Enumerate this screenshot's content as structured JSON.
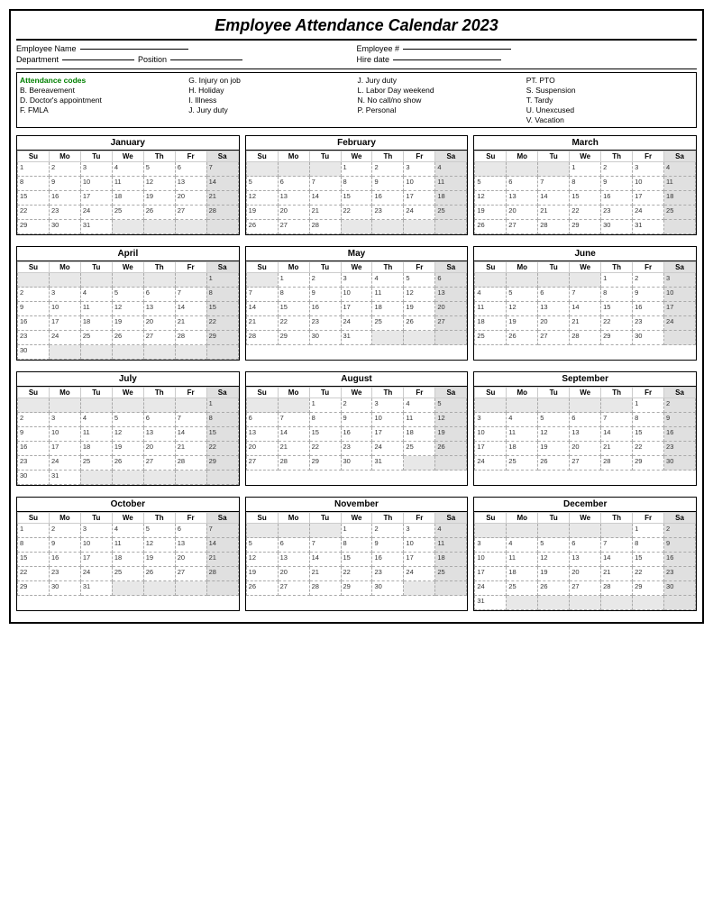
{
  "title": "Employee Attendance Calendar 2023",
  "fields": {
    "emp_name_label": "Employee Name",
    "dept_label": "Department",
    "position_label": "Position",
    "emp_num_label": "Employee #",
    "hire_date_label": "Hire date"
  },
  "codes": {
    "title": "Attendance codes",
    "col1": [
      "B. Bereavement",
      "D. Doctor's appointment",
      "F.  FMLA"
    ],
    "col2": [
      "G. Injury on job",
      "H. Holiday",
      "I.  Illness",
      "J. Jury duty"
    ],
    "col3": [
      "J.  Jury duty",
      "L. Labor Day weekend",
      "N. No call/no show",
      "P. Personal"
    ],
    "col4": [
      "PT. PTO",
      "S. Suspension",
      "T. Tardy",
      "U. Unexcused",
      "V. Vacation"
    ]
  },
  "months": [
    {
      "name": "January",
      "days": [
        1,
        2,
        3,
        4,
        5,
        6,
        7,
        8,
        9,
        10,
        11,
        12,
        13,
        14,
        15,
        16,
        17,
        18,
        19,
        20,
        21,
        22,
        23,
        24,
        25,
        26,
        27,
        28,
        29,
        30,
        31
      ],
      "startDay": 0
    },
    {
      "name": "February",
      "days": [
        1,
        2,
        3,
        4,
        5,
        6,
        7,
        8,
        9,
        10,
        11,
        12,
        13,
        14,
        15,
        16,
        17,
        18,
        19,
        20,
        21,
        22,
        23,
        24,
        25,
        26,
        27,
        28
      ],
      "startDay": 3
    },
    {
      "name": "March",
      "days": [
        1,
        2,
        3,
        4,
        5,
        6,
        7,
        8,
        9,
        10,
        11,
        12,
        13,
        14,
        15,
        16,
        17,
        18,
        19,
        20,
        21,
        22,
        23,
        24,
        25,
        26,
        27,
        28,
        29,
        30,
        31
      ],
      "startDay": 3
    },
    {
      "name": "April",
      "days": [
        1,
        2,
        3,
        4,
        5,
        6,
        7,
        8,
        9,
        10,
        11,
        12,
        13,
        14,
        15,
        16,
        17,
        18,
        19,
        20,
        21,
        22,
        23,
        24,
        25,
        26,
        27,
        28,
        29,
        30
      ],
      "startDay": 6
    },
    {
      "name": "May",
      "days": [
        1,
        2,
        3,
        4,
        5,
        6,
        7,
        8,
        9,
        10,
        11,
        12,
        13,
        14,
        15,
        16,
        17,
        18,
        19,
        20,
        21,
        22,
        23,
        24,
        25,
        26,
        27,
        28,
        29,
        30,
        31
      ],
      "startDay": 1
    },
    {
      "name": "June",
      "days": [
        1,
        2,
        3,
        4,
        5,
        6,
        7,
        8,
        9,
        10,
        11,
        12,
        13,
        14,
        15,
        16,
        17,
        18,
        19,
        20,
        21,
        22,
        23,
        24,
        25,
        26,
        27,
        28,
        29,
        30
      ],
      "startDay": 4
    },
    {
      "name": "July",
      "days": [
        1,
        2,
        3,
        4,
        5,
        6,
        7,
        8,
        9,
        10,
        11,
        12,
        13,
        14,
        15,
        16,
        17,
        18,
        19,
        20,
        21,
        22,
        23,
        24,
        25,
        26,
        27,
        28,
        29,
        30,
        31
      ],
      "startDay": 6
    },
    {
      "name": "August",
      "days": [
        1,
        2,
        3,
        4,
        5,
        6,
        7,
        8,
        9,
        10,
        11,
        12,
        13,
        14,
        15,
        16,
        17,
        18,
        19,
        20,
        21,
        22,
        23,
        24,
        25,
        26,
        27,
        28,
        29,
        30,
        31
      ],
      "startDay": 2
    },
    {
      "name": "September",
      "days": [
        1,
        2,
        3,
        4,
        5,
        6,
        7,
        8,
        9,
        10,
        11,
        12,
        13,
        14,
        15,
        16,
        17,
        18,
        19,
        20,
        21,
        22,
        23,
        24,
        25,
        26,
        27,
        28,
        29,
        30
      ],
      "startDay": 5
    },
    {
      "name": "October",
      "days": [
        1,
        2,
        3,
        4,
        5,
        6,
        7,
        8,
        9,
        10,
        11,
        12,
        13,
        14,
        15,
        16,
        17,
        18,
        19,
        20,
        21,
        22,
        23,
        24,
        25,
        26,
        27,
        28,
        29,
        30,
        31
      ],
      "startDay": 0
    },
    {
      "name": "November",
      "days": [
        1,
        2,
        3,
        4,
        5,
        6,
        7,
        8,
        9,
        10,
        11,
        12,
        13,
        14,
        15,
        16,
        17,
        18,
        19,
        20,
        21,
        22,
        23,
        24,
        25,
        26,
        27,
        28,
        29,
        30
      ],
      "startDay": 3
    },
    {
      "name": "December",
      "days": [
        1,
        2,
        3,
        4,
        5,
        6,
        7,
        8,
        9,
        10,
        11,
        12,
        13,
        14,
        15,
        16,
        17,
        18,
        19,
        20,
        21,
        22,
        23,
        24,
        25,
        26,
        27,
        28,
        29,
        30,
        31
      ],
      "startDay": 5
    }
  ],
  "weekdays": [
    "Su",
    "Mo",
    "Tu",
    "We",
    "Th",
    "Fr",
    "Sa"
  ]
}
